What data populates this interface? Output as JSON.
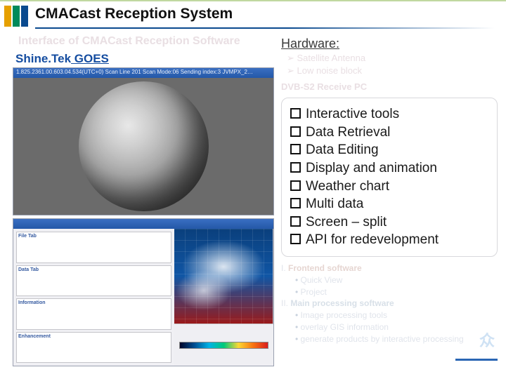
{
  "header": {
    "title": "CMACast Reception System"
  },
  "left": {
    "ghost_heading": "Interface of CMACast Reception Software",
    "subtitle_brand": "Shine.Tek",
    "subtitle_rest": " GOES",
    "ss1_titlebar": "1.825.2361.00.603.04.534(UTC+0) Scan Line 201 Scan Mode:06 Sending index:3 JVMPX_2…",
    "ss2_panels": {
      "p1": "File Tab",
      "p2": "Data Tab",
      "p3": "Information",
      "p4": "Enhancement"
    }
  },
  "right": {
    "hw_heading": "Hardware:",
    "hw_items": [
      "Satellite Antenna",
      "Low noise block"
    ],
    "ghost_sw": "DVB-S2 Receive PC",
    "features": [
      "Interactive tools",
      "Data Retrieval",
      "Data Editing",
      "Display and animation",
      "Weather chart",
      "Multi data",
      "Screen – split",
      "API for redevelopment"
    ],
    "ghost_footer": {
      "i_label": "I.",
      "i_text": "Frontend software",
      "i_subs": [
        "Quick View",
        "Project"
      ],
      "ii_label": "II.",
      "ii_text": "Main processing software",
      "ii_subs": [
        "Image processing tools",
        "overlay GIS information",
        "generate products by interactive processing"
      ]
    }
  },
  "brand": "众"
}
